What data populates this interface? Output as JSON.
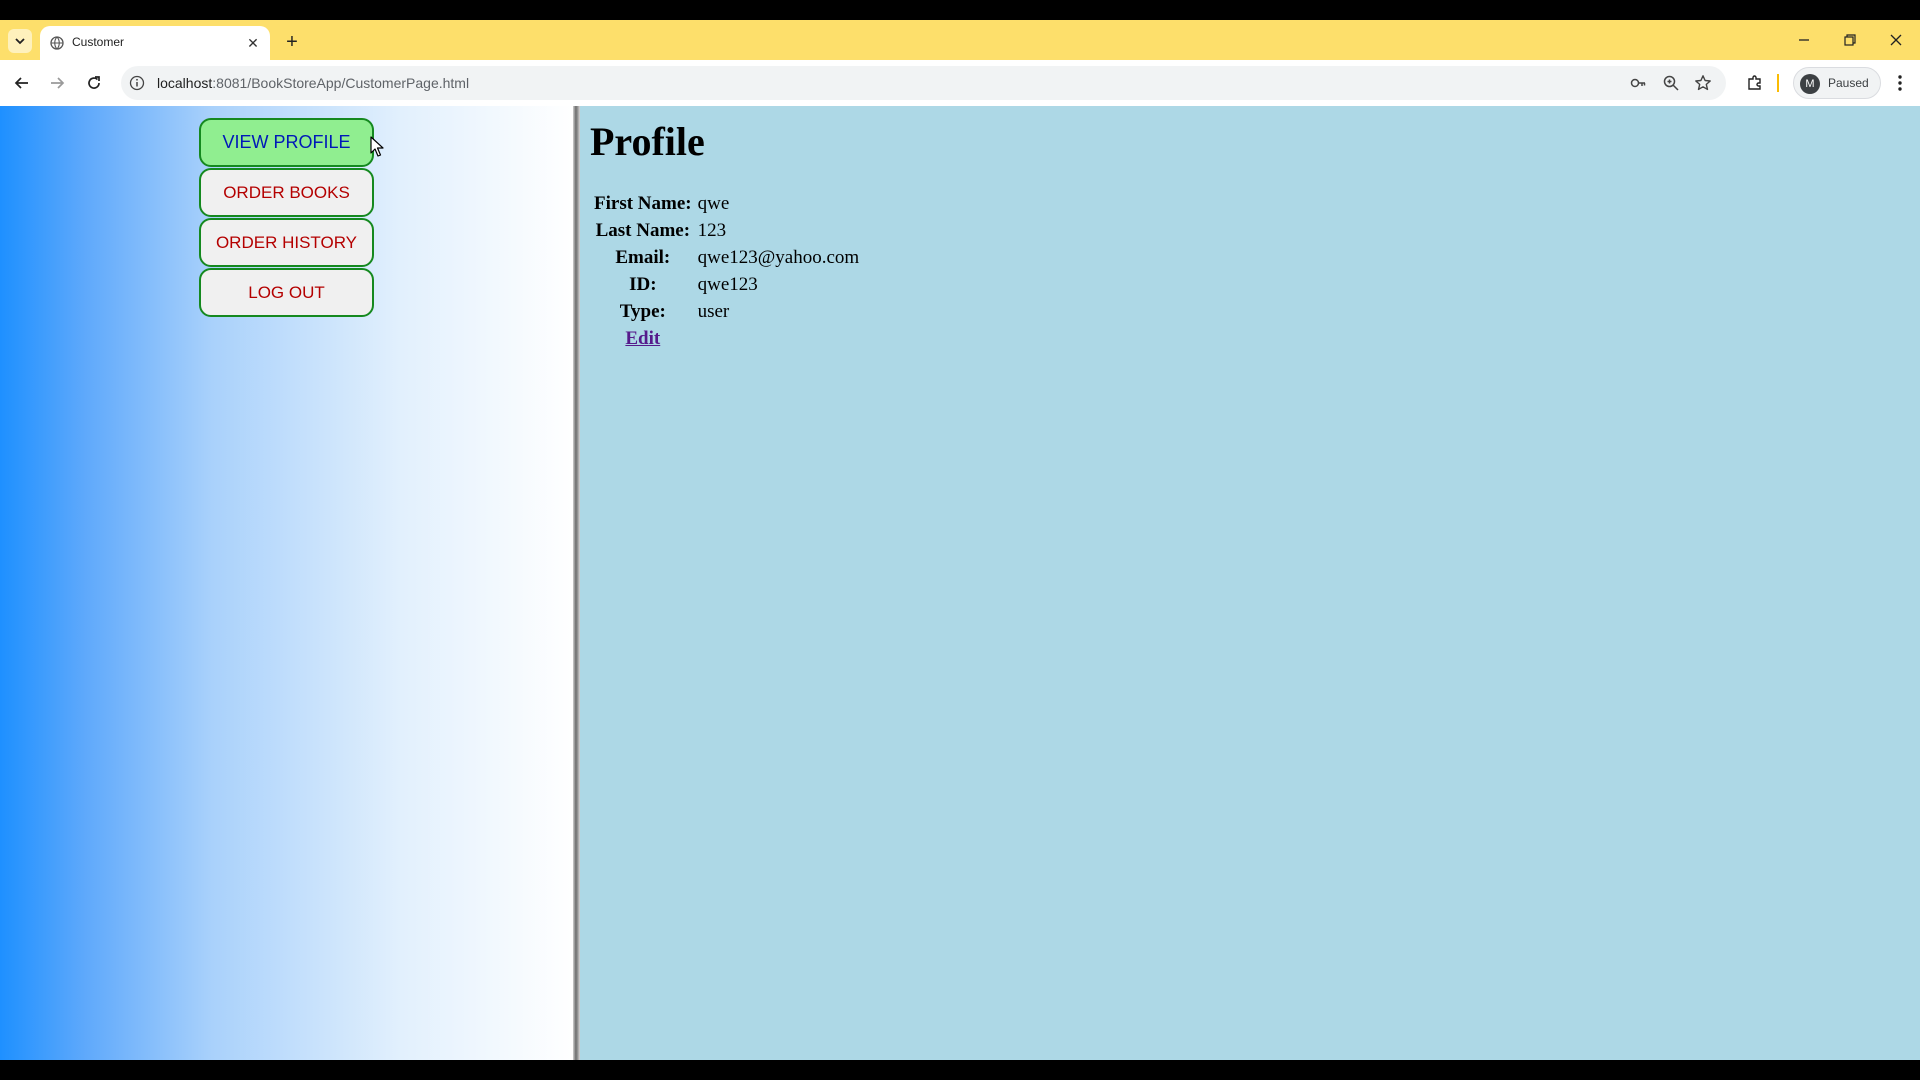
{
  "browser": {
    "tab_title": "Customer",
    "url_host": "localhost",
    "url_rest": ":8081/BookStoreApp/CustomerPage.html",
    "profile_initial": "M",
    "profile_status": "Paused"
  },
  "sidebar": {
    "buttons": [
      {
        "label": "VIEW PROFILE",
        "active": true
      },
      {
        "label": "ORDER BOOKS",
        "active": false
      },
      {
        "label": "ORDER HISTORY",
        "active": false
      },
      {
        "label": "LOG OUT",
        "active": false
      }
    ]
  },
  "profile": {
    "title": "Profile",
    "fields": [
      {
        "label": "First Name:",
        "value": "qwe"
      },
      {
        "label": "Last Name:",
        "value": "123"
      },
      {
        "label": "Email:",
        "value": "qwe123@yahoo.com"
      },
      {
        "label": "ID:",
        "value": "qwe123"
      },
      {
        "label": "Type:",
        "value": "user"
      }
    ],
    "edit_label": "Edit"
  },
  "colors": {
    "chrome_bg": "#fddf6b",
    "content_bg": "#add8e6",
    "button_active_bg": "#90ee90",
    "button_border": "#15891f",
    "button_text": "#b40000",
    "button_active_text": "#0018b8"
  }
}
